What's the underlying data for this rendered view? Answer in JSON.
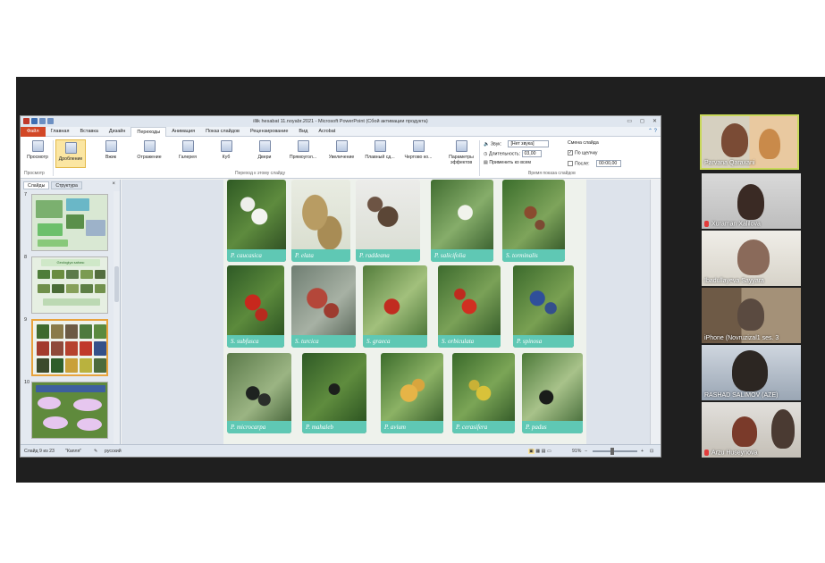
{
  "app": {
    "window_title": "illik hesabat 11.noyabr.2021 - Microsoft PowerPoint (Сбой активации продукта)",
    "tabs": [
      "Файл",
      "Главная",
      "Вставка",
      "Дизайн",
      "Переходы",
      "Анимация",
      "Показ слайдов",
      "Рецензирование",
      "Вид",
      "Acrobat"
    ],
    "active_tab": "Переходы"
  },
  "ribbon": {
    "preview_label": "Просмотр",
    "preview_group": "Просмотр",
    "transitions": [
      "Дробление",
      "Вжик",
      "Отражение",
      "Галерея",
      "Куб",
      "Двери",
      "Прямоугол...",
      "Увеличение",
      "Плавный сд...",
      "Чертово ко..."
    ],
    "transitions_group": "Переход к этому слайду",
    "effect_params": "Параметры эффектов",
    "sound_label": "Звук:",
    "sound_value": "[Нет звука]",
    "duration_label": "Длительность:",
    "duration_value": "03,00",
    "apply_all": "Применить ко всем",
    "change_slide_label": "Смена слайда",
    "on_click": "По щелчку",
    "after_label": "После:",
    "after_value": "00:00,00",
    "timing_group": "Время показа слайдов"
  },
  "slide_pane": {
    "tab_slides": "Слайды",
    "tab_outline": "Структура",
    "close": "×",
    "numbers": [
      "7",
      "8",
      "9",
      "10"
    ],
    "selected_number": "9",
    "thumb_8_title": "Geologiya sahası"
  },
  "slide": {
    "captions_row1": [
      "P. caucasica",
      "P. elata",
      "P. raddeana",
      "P. salicifolia",
      "S. torminalis"
    ],
    "captions_row2": [
      "S. subfusca",
      "S. turcica",
      "S. graeca",
      "S. orbiculata",
      "P. spinosa"
    ],
    "captions_row3": [
      "P. microcarpa",
      "P. mahaleb",
      "P. avium",
      "P. cerasifera",
      "P. padus"
    ]
  },
  "statusbar": {
    "slide_info": "Слайд 9 из 23",
    "theme": "\"Капля\"",
    "language": "русский",
    "zoom": "91%"
  },
  "participants": [
    {
      "name": "Parvana Qaraxani",
      "active": true
    },
    {
      "name": "Xuraman Xalilova",
      "muted": true
    },
    {
      "name": "Ibadullayeva Sayyara",
      "muted": false
    },
    {
      "name": "iPhone (Novruzizal1 ses. 3",
      "muted": false
    },
    {
      "name": "RASHAD SALIMOV (AZE)",
      "muted": false
    },
    {
      "name": "Arzu Huseynova",
      "muted": true
    }
  ],
  "colors": {
    "caption_bg": "#5fc8b4",
    "file_tab": "#d24726",
    "active_speaker_border": "#c8d85a",
    "mute_icon": "#e23b3b"
  }
}
